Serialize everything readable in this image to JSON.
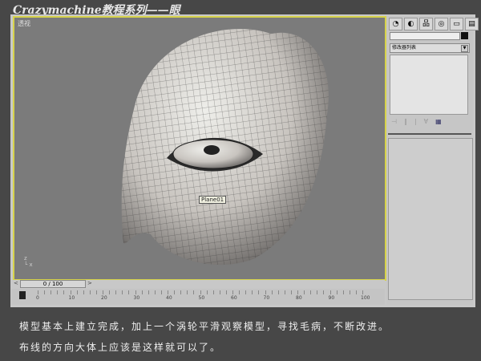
{
  "title": "Crazymachine教程系列——眼",
  "viewport": {
    "label": "透视",
    "object_label": "Plane01"
  },
  "scroll": {
    "position": "0 / 100",
    "left": "<",
    "right": ">"
  },
  "timeline": {
    "ticks": [
      "0",
      "10",
      "20",
      "30",
      "40",
      "50",
      "60",
      "70",
      "80",
      "90",
      "100"
    ]
  },
  "panel": {
    "tabs": [
      "create-icon",
      "modify-icon",
      "hierarchy-icon",
      "motion-icon",
      "display-icon",
      "utilities-icon"
    ],
    "modifier_list": "修改器列表",
    "dropdown": "▼"
  },
  "captions": [
    "模型基本上建立完成，加上一个涡轮平滑观察模型，寻找毛病，不断改进。",
    "布线的方向大体上应该是这样就可以了。"
  ],
  "colors": {
    "viewport_border": "#d7d34a",
    "viewport_bg": "#7b7b7b",
    "background": "#474747"
  }
}
